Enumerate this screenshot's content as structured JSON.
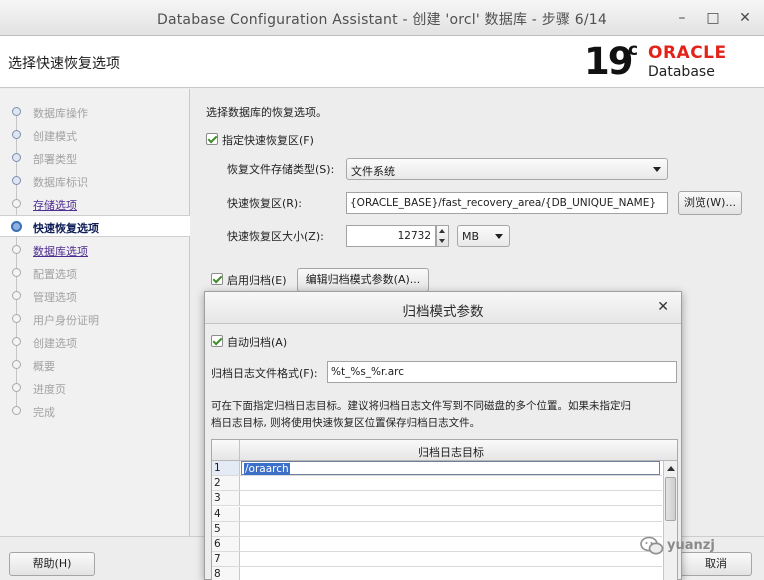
{
  "window": {
    "title": "Database Configuration Assistant - 创建 'orcl' 数据库 - 步骤 6/14",
    "minimize": "–",
    "maximize": "□",
    "close": "✕"
  },
  "header": {
    "step_title": "选择快速恢复选项",
    "logo_version": "19",
    "logo_sup": "c",
    "logo_brand": "ORACLE",
    "logo_product": "Database"
  },
  "nav": {
    "items": [
      {
        "label": "数据库操作",
        "state": "done"
      },
      {
        "label": "创建模式",
        "state": "done"
      },
      {
        "label": "部署类型",
        "state": "done"
      },
      {
        "label": "数据库标识",
        "state": "done"
      },
      {
        "label": "存储选项",
        "state": "link"
      },
      {
        "label": "快速恢复选项",
        "state": "active"
      },
      {
        "label": "数据库选项",
        "state": "link"
      },
      {
        "label": "配置选项",
        "state": "pending"
      },
      {
        "label": "管理选项",
        "state": "pending"
      },
      {
        "label": "用户身份证明",
        "state": "pending"
      },
      {
        "label": "创建选项",
        "state": "pending"
      },
      {
        "label": "概要",
        "state": "pending"
      },
      {
        "label": "进度页",
        "state": "pending"
      },
      {
        "label": "完成",
        "state": "pending"
      }
    ]
  },
  "main": {
    "intro": "选择数据库的恢复选项。",
    "fra_checkbox": "指定快速恢复区(F)",
    "storage_type_label": "恢复文件存储类型(S):",
    "storage_type_value": "文件系统",
    "fra_location_label": "快速恢复区(R):",
    "fra_location_value": "{ORACLE_BASE}/fast_recovery_area/{DB_UNIQUE_NAME}",
    "browse_button": "浏览(W)...",
    "fra_size_label": "快速恢复区大小(Z):",
    "fra_size_value": "12732",
    "fra_size_unit": "MB",
    "archive_checkbox": "启用归档(E)",
    "edit_archive_button": "编辑归档模式参数(A)..."
  },
  "dialog": {
    "title": "归档模式参数",
    "close": "✕",
    "auto_archive_checkbox": "自动归档(A)",
    "log_format_label": "归档日志文件格式(F):",
    "log_format_value": "%t_%s_%r.arc",
    "hint_line1": "可在下面指定归档日志目标。建议将归档日志文件写到不同磁盘的多个位置。如果未指定归",
    "hint_line2": "档日志目标, 则将使用快速恢复区位置保存归档日志文件。",
    "table_header": "归档日志目标",
    "rows": [
      {
        "n": "1",
        "dest": "/oraarch"
      },
      {
        "n": "2",
        "dest": ""
      },
      {
        "n": "3",
        "dest": ""
      },
      {
        "n": "4",
        "dest": ""
      },
      {
        "n": "5",
        "dest": ""
      },
      {
        "n": "6",
        "dest": ""
      },
      {
        "n": "7",
        "dest": ""
      },
      {
        "n": "8",
        "dest": ""
      }
    ]
  },
  "footer": {
    "help_button": "帮助(H)",
    "cancel_button": "取消"
  },
  "watermark": {
    "icon": "wechat-icon",
    "text": "yuanzj"
  }
}
